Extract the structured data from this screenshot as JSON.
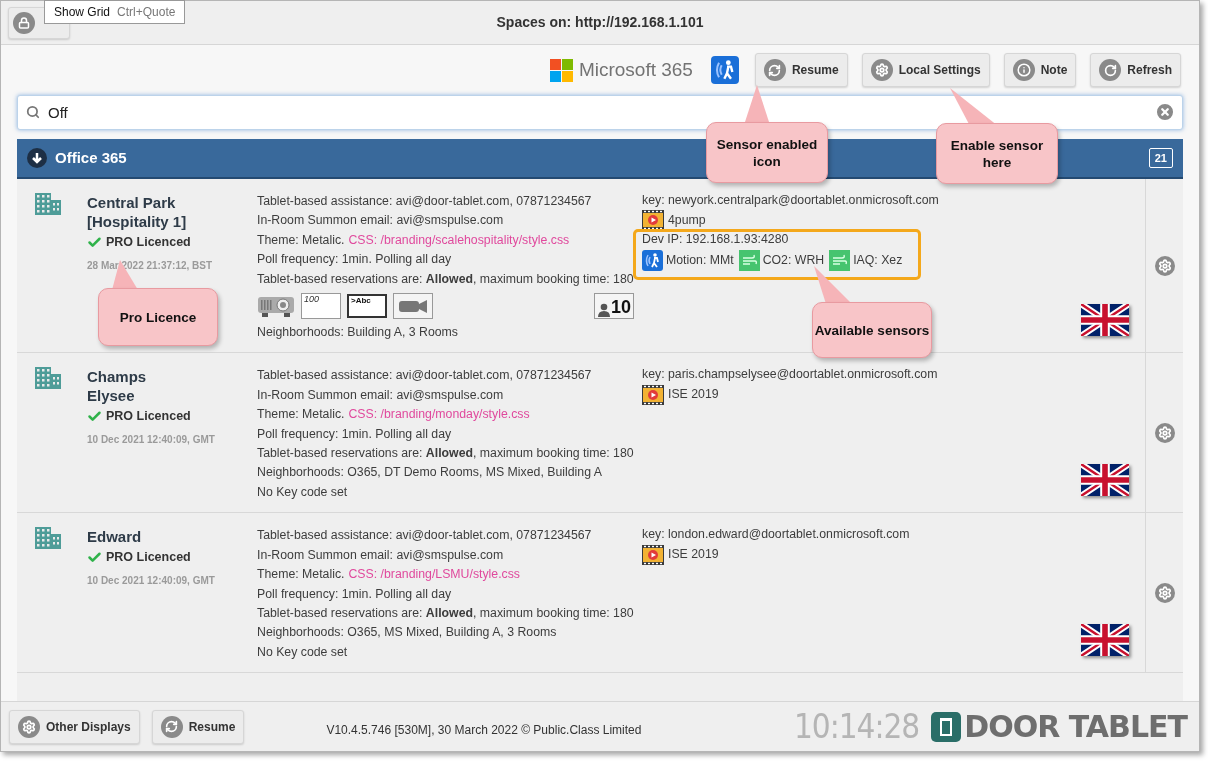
{
  "window": {
    "title": "Spaces on: http://192.168.1.101"
  },
  "tooltip": {
    "label": "Show Grid",
    "shortcut": "Ctrl+Quote"
  },
  "toolbar": {
    "brand": "Microsoft 365",
    "sensor_enabled": true,
    "buttons": [
      {
        "label": "Resume"
      },
      {
        "label": "Local Settings"
      },
      {
        "label": "Note"
      },
      {
        "label": "Refresh"
      }
    ]
  },
  "search": {
    "value": "Off"
  },
  "group": {
    "title": "Office 365",
    "expanded": true,
    "count": "21"
  },
  "rooms": [
    {
      "name": "Central Park [Hospitality 1]",
      "licence": "PRO Licenced",
      "licenced": true,
      "timestamp": "28 Mar 2022 21:37:12, BST",
      "assistance": "Tablet-based assistance: avi@door-tablet.com, 07871234567",
      "summon": "In-Room Summon email: avi@smspulse.com",
      "theme": "Theme: Metalic.",
      "css": "CSS: /branding/scalehospitality/style.css",
      "poll": "Poll frequency: 1min. Polling all day",
      "reservations": "Tablet-based reservations are: **Allowed**, maximum booking time: 180",
      "equipment": [
        {
          "kind": "projector"
        },
        {
          "kind": "counter",
          "label": "100"
        },
        {
          "kind": "display",
          "label": ">Abc"
        },
        {
          "kind": "camera"
        }
      ],
      "capacity": "10",
      "neighborhoods": "Neighborhoods: Building A, 3 Rooms",
      "key": "key: newyork.centralpark@doortablet.onmicrosoft.com",
      "calendar": "4pump",
      "dev_ip": "Dev IP: 192.168.1.93:4280",
      "sensors": [
        {
          "kind": "motion",
          "label": "Motion: MMt"
        },
        {
          "kind": "air",
          "label": "CO2: WRH"
        },
        {
          "kind": "air",
          "label": "IAQ: Xez"
        }
      ]
    },
    {
      "name": "Champs Elysee",
      "licence": "PRO Licenced",
      "licenced": true,
      "timestamp": "10 Dec 2021 12:40:09, GMT",
      "assistance": "Tablet-based assistance: avi@door-tablet.com, 07871234567",
      "summon": "In-Room Summon email: avi@smspulse.com",
      "theme": "Theme: Metalic.",
      "css": "CSS: /branding/monday/style.css",
      "poll": "Poll frequency: 1min. Polling all day",
      "reservations": "Tablet-based reservations are: **Allowed**, maximum booking time: 180",
      "neighborhoods": "Neighborhoods: O365, DT Demo Rooms, MS Mixed, Building A",
      "key_code": "No Key code set",
      "key": "key: paris.champselysee@doortablet.onmicrosoft.com",
      "calendar": "ISE 2019"
    },
    {
      "name": "Edward",
      "licence": "PRO Licenced",
      "licenced": true,
      "timestamp": "10 Dec 2021 12:40:09, GMT",
      "assistance": "Tablet-based assistance: avi@door-tablet.com, 07871234567",
      "summon": "In-Room Summon email: avi@smspulse.com",
      "theme": "Theme: Metalic.",
      "css": "CSS: /branding/LSMU/style.css",
      "poll": "Poll frequency: 1min. Polling all day",
      "reservations": "Tablet-based reservations are: **Allowed**, maximum booking time: 180",
      "neighborhoods": "Neighborhoods: O365, MS Mixed, Building A, 3 Rooms",
      "key_code": "No Key code set",
      "key": "key: london.edward@doortablet.onmicrosoft.com",
      "calendar": "ISE 2019"
    }
  ],
  "footer": {
    "buttons": [
      {
        "label": "Other Displays"
      },
      {
        "label": "Resume"
      }
    ],
    "version": "V10.4.5.746 [530M], 30 March 2022 © Public.Class Limited",
    "clock": "10:14:28",
    "logo": "DOOR TABLET"
  },
  "callouts": [
    {
      "text": "Sensor enabled icon"
    },
    {
      "text": "Enable sensor here"
    },
    {
      "text": "Pro Licence"
    },
    {
      "text": "Available sensors"
    }
  ]
}
